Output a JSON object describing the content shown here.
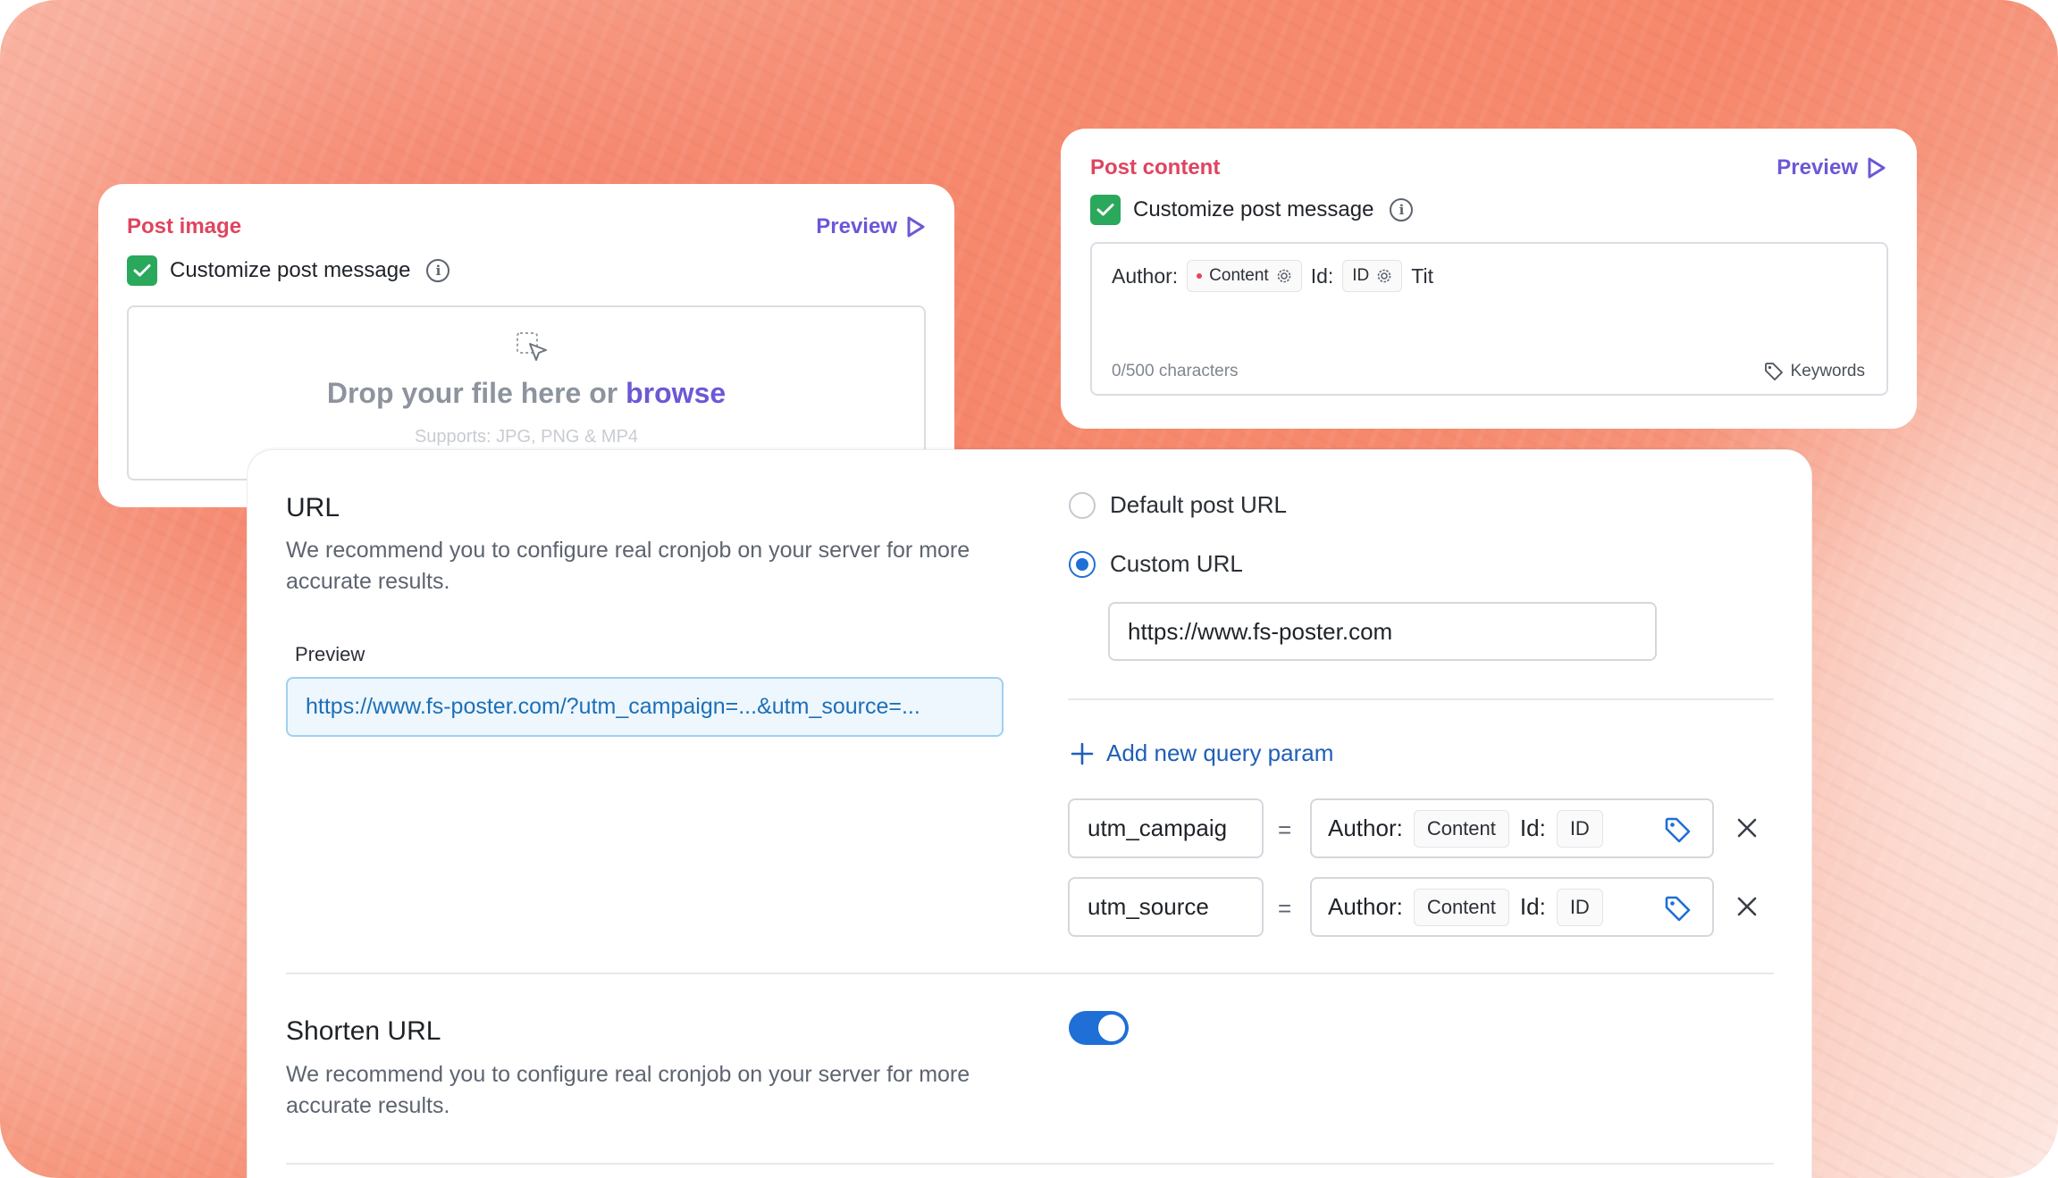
{
  "post_image": {
    "title": "Post image",
    "preview_label": "Preview",
    "customize_label": "Customize post message",
    "drop_text": "Drop your file here or",
    "browse_label": "browse",
    "supports_text": "Supports: JPG, PNG & MP4"
  },
  "post_content": {
    "title": "Post content",
    "preview_label": "Preview",
    "customize_label": "Customize post message",
    "message": {
      "author_label": "Author:",
      "content_chip": "Content",
      "id_label": "Id:",
      "id_chip": "ID",
      "trailing_text": "Tit"
    },
    "char_count": "0/500 characters",
    "keywords_label": "Keywords"
  },
  "url_section": {
    "title": "URL",
    "description": "We recommend you to configure real cronjob on your server for more accurate results.",
    "preview_label": "Preview",
    "preview_value": "https://www.fs-poster.com/?utm_campaign=...&utm_source=...",
    "default_option": "Default post URL",
    "custom_option": "Custom URL",
    "custom_url_value": "https://www.fs-poster.com",
    "add_param_label": "Add new query param",
    "params": [
      {
        "key": "utm_campaig",
        "eq": "=",
        "author_label": "Author:",
        "content_chip": "Content",
        "id_label": "Id:",
        "id_chip": "ID"
      },
      {
        "key": "utm_source",
        "eq": "=",
        "author_label": "Author:",
        "content_chip": "Content",
        "id_label": "Id:",
        "id_chip": "ID"
      }
    ]
  },
  "shorten_section": {
    "title": "Shorten URL",
    "description": "We recommend you to configure real cronjob on your server for more accurate results.",
    "enabled": true
  },
  "colors": {
    "accent_red": "#e0445f",
    "accent_purple": "#6b58d6",
    "link_blue": "#1f5fb8",
    "toggle_blue": "#1f6fd6",
    "check_green": "#2aa85c"
  }
}
